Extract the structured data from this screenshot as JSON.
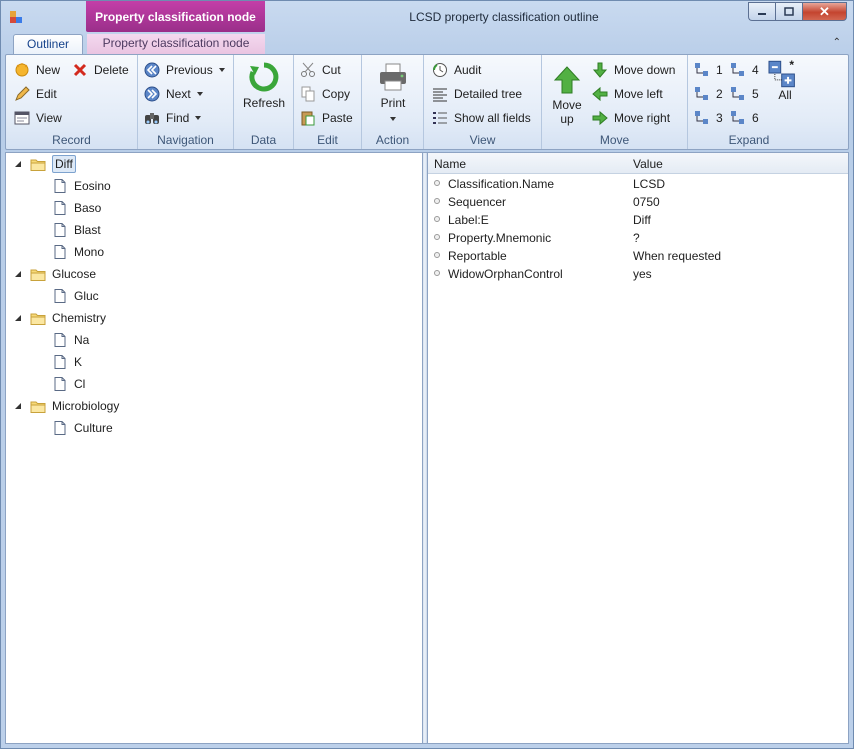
{
  "window": {
    "title": "LCSD property classification outline",
    "context_tab_title": "Property classification node"
  },
  "tabs": {
    "outliner": "Outliner",
    "property_node": "Property classification node"
  },
  "ribbon": {
    "record": {
      "label": "Record",
      "new": "New",
      "delete": "Delete",
      "edit": "Edit",
      "view": "View"
    },
    "navigation": {
      "label": "Navigation",
      "previous": "Previous",
      "next": "Next",
      "find": "Find"
    },
    "data": {
      "label": "Data",
      "refresh": "Refresh"
    },
    "edit": {
      "label": "Edit",
      "cut": "Cut",
      "copy": "Copy",
      "paste": "Paste"
    },
    "action": {
      "label": "Action",
      "print": "Print"
    },
    "view": {
      "label": "View",
      "audit": "Audit",
      "detailed_tree": "Detailed tree",
      "show_all_fields": "Show all fields"
    },
    "move": {
      "label": "Move",
      "move_up_1": "Move",
      "move_up_2": "up",
      "move_down": "Move down",
      "move_left": "Move left",
      "move_right": "Move right"
    },
    "expand": {
      "label": "Expand",
      "l1": "1",
      "l2": "2",
      "l3": "3",
      "l4": "4",
      "l5": "5",
      "l6": "6",
      "star": "*",
      "all": "All"
    }
  },
  "tree": {
    "groups": [
      {
        "label": "Diff",
        "children": [
          "Eosino",
          "Baso",
          "Blast",
          "Mono"
        ]
      },
      {
        "label": "Glucose",
        "children": [
          "Gluc"
        ]
      },
      {
        "label": "Chemistry",
        "children": [
          "Na",
          "K",
          "Cl"
        ]
      },
      {
        "label": "Microbiology",
        "children": [
          "Culture"
        ]
      }
    ]
  },
  "grid": {
    "columns": {
      "name": "Name",
      "value": "Value"
    },
    "rows": [
      {
        "name": "Classification.Name",
        "value": "LCSD"
      },
      {
        "name": "Sequencer",
        "value": "0750"
      },
      {
        "name": "Label:E",
        "value": "Diff"
      },
      {
        "name": "Property.Mnemonic",
        "value": "?"
      },
      {
        "name": "Reportable",
        "value": "When requested"
      },
      {
        "name": "WidowOrphanControl",
        "value": "yes"
      }
    ]
  },
  "colors": {
    "accent": "#15428b",
    "context_tab": "#b0389a",
    "selection": "#dde9f7"
  }
}
